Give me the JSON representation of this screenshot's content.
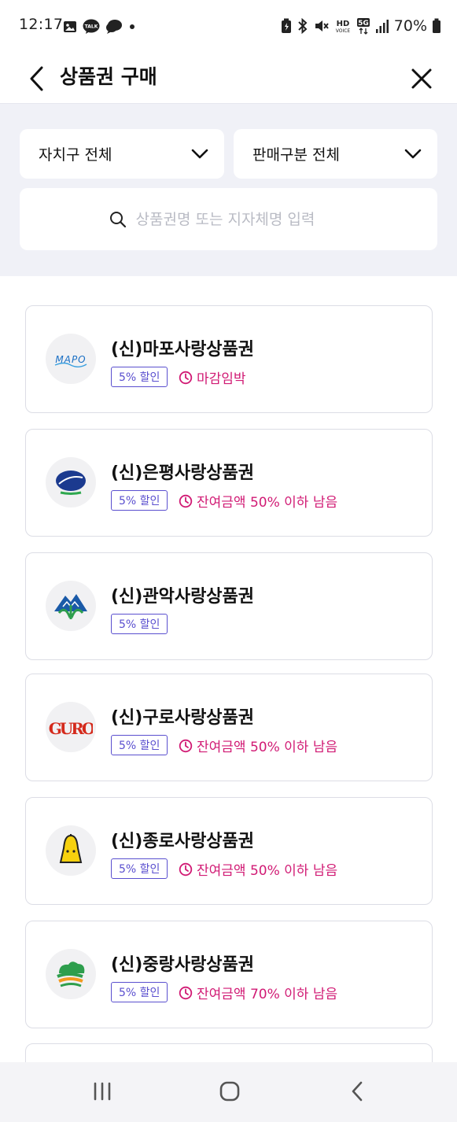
{
  "status_bar": {
    "time": "12:17",
    "left_icons": [
      "gallery-icon",
      "kakaotalk-icon",
      "chat-bubble-icon",
      "dot-icon"
    ],
    "right_icons": [
      "battery-saver-icon",
      "bluetooth-icon",
      "mute-icon",
      "hd-voice-icon",
      "5g-icon",
      "signal-icon"
    ],
    "battery": "70%"
  },
  "app_bar": {
    "title": "상품권 구매"
  },
  "filters": {
    "district_label": "자치구 전체",
    "sale_type_label": "판매구분 전체",
    "search_placeholder": "상품권명 또는 지자체명 입력",
    "search_value": ""
  },
  "vouchers": [
    {
      "name": "(신)마포사랑상품권",
      "discount": "5% 할인",
      "note": "마감임박",
      "logo": "mapo-logo",
      "logo_text": "MAPO"
    },
    {
      "name": "(신)은평사랑상품권",
      "discount": "5% 할인",
      "note": "잔여금액 50% 이하 남음",
      "logo": "eunpyeong-logo"
    },
    {
      "name": "(신)관악사랑상품권",
      "discount": "5% 할인",
      "note": "",
      "logo": "gwanak-logo"
    },
    {
      "name": "(신)구로사랑상품권",
      "discount": "5% 할인",
      "note": "잔여금액 50% 이하 남음",
      "logo": "guro-logo",
      "logo_text": "GURO"
    },
    {
      "name": "(신)종로사랑상품권",
      "discount": "5% 할인",
      "note": "잔여금액 50% 이하 남음",
      "logo": "jongno-logo"
    },
    {
      "name": "(신)중랑사랑상품권",
      "discount": "5% 할인",
      "note": "잔여금액 70% 이하 남음",
      "logo": "jungnang-logo"
    }
  ],
  "colors": {
    "accent_purple": "#5a4fcf",
    "alert_pink": "#d11a74",
    "panel_bg": "#f0f1f7"
  },
  "nav_bar": {
    "buttons": [
      "recent-apps-icon",
      "home-icon",
      "back-icon"
    ]
  }
}
